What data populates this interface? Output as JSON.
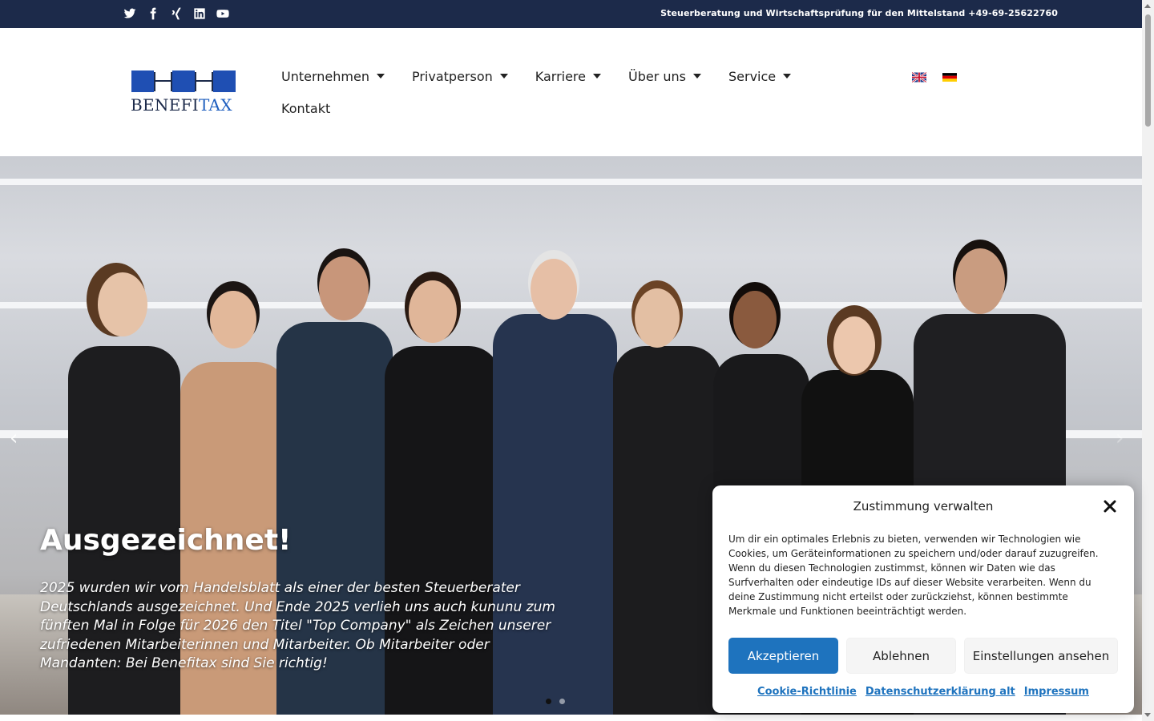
{
  "topbar": {
    "social": [
      {
        "name": "twitter-icon"
      },
      {
        "name": "facebook-icon"
      },
      {
        "name": "xing-icon"
      },
      {
        "name": "linkedin-icon"
      },
      {
        "name": "youtube-icon"
      }
    ],
    "tagline": "Steuerberatung und Wirtschaftsprüfung für den Mittelstand +49-69-25622760",
    "background": "#1c2a4a"
  },
  "logo": {
    "part1": "BENEFI",
    "part2": "TAX"
  },
  "nav": {
    "items": [
      {
        "label": "Unternehmen"
      },
      {
        "label": "Privatperson"
      },
      {
        "label": "Karriere"
      },
      {
        "label": "Über uns"
      },
      {
        "label": "Service"
      }
    ],
    "kontakt": "Kontakt"
  },
  "languages": [
    "english-flag-icon",
    "german-flag-icon"
  ],
  "hero": {
    "title": "Ausgezeichnet!",
    "text": "2025 wurden wir vom Handelsblatt als einer der besten Steuerberater Deutschlands ausgezeichnet. Und Ende 2025 verlieh uns auch kununu zum fünften Mal in Folge für 2026 den Titel \"Top Company\" als Zeichen unserer zufriedenen Mitarbeiterinnen und Mitarbeiter. Ob Mitarbeiter oder Mandanten: Bei Benefitax sind Sie richtig!",
    "arrow_left": "‹",
    "arrow_right": "›",
    "slide_count": 2,
    "active_slide": 1
  },
  "cookie": {
    "title": "Zustimmung verwalten",
    "text": "Um dir ein optimales Erlebnis zu bieten, verwenden wir Technologien wie Cookies, um Geräteinformationen zu speichern und/oder darauf zuzugreifen. Wenn du diesen Technologien zustimmst, können wir Daten wie das Surfverhalten oder eindeutige IDs auf dieser Website verarbeiten. Wenn du deine Zustimmung nicht erteilst oder zurückziehst, können bestimmte Merkmale und Funktionen beeinträchtigt werden.",
    "accept": "Akzeptieren",
    "deny": "Ablehnen",
    "settings": "Einstellungen ansehen",
    "links": [
      "Cookie-Richtlinie",
      "Datenschutzerklärung alt",
      "Impressum"
    ],
    "accent": "#1e73be"
  }
}
